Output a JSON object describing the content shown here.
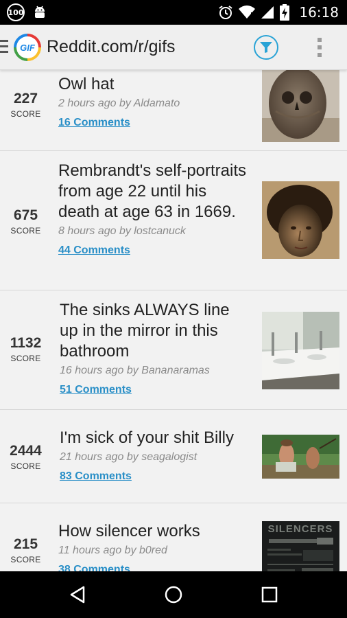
{
  "status_bar": {
    "badge": "100",
    "time": "16:18"
  },
  "app_bar": {
    "title": "Reddit.com/r/gifs",
    "logo_text": "GIF",
    "icons": [
      "hamburger-icon",
      "app-logo",
      "filter-icon",
      "overflow-menu-icon"
    ]
  },
  "posts": [
    {
      "score": "227",
      "score_label": "SCORE",
      "title": "Owl hat",
      "meta": "2 hours ago by Aldamato",
      "comments": "16 Comments",
      "thumb": "owl"
    },
    {
      "score": "675",
      "score_label": "SCORE",
      "title": "Rembrandt's self-portraits from age 22 until his death at age 63 in 1669.",
      "meta": "8 hours ago by lostcanuck",
      "comments": "44 Comments",
      "thumb": "portrait"
    },
    {
      "score": "1132",
      "score_label": "SCORE",
      "title": "The sinks ALWAYS line up in the mirror in this bathroom",
      "meta": "16 hours ago by Bananaramas",
      "comments": "51 Comments",
      "thumb": "sink"
    },
    {
      "score": "2444",
      "score_label": "SCORE",
      "title": "I'm sick of your shit Billy",
      "meta": "21 hours ago by seagalogist",
      "comments": "83 Comments",
      "thumb": "movie"
    },
    {
      "score": "215",
      "score_label": "SCORE",
      "title": "How silencer works",
      "meta": "11 hours ago by b0red",
      "comments": "38 Comments",
      "thumb": "silencers",
      "thumb_text": "SILENCERS"
    }
  ],
  "nav_bar": {
    "icons": [
      "back-icon",
      "home-icon",
      "recents-icon"
    ]
  }
}
